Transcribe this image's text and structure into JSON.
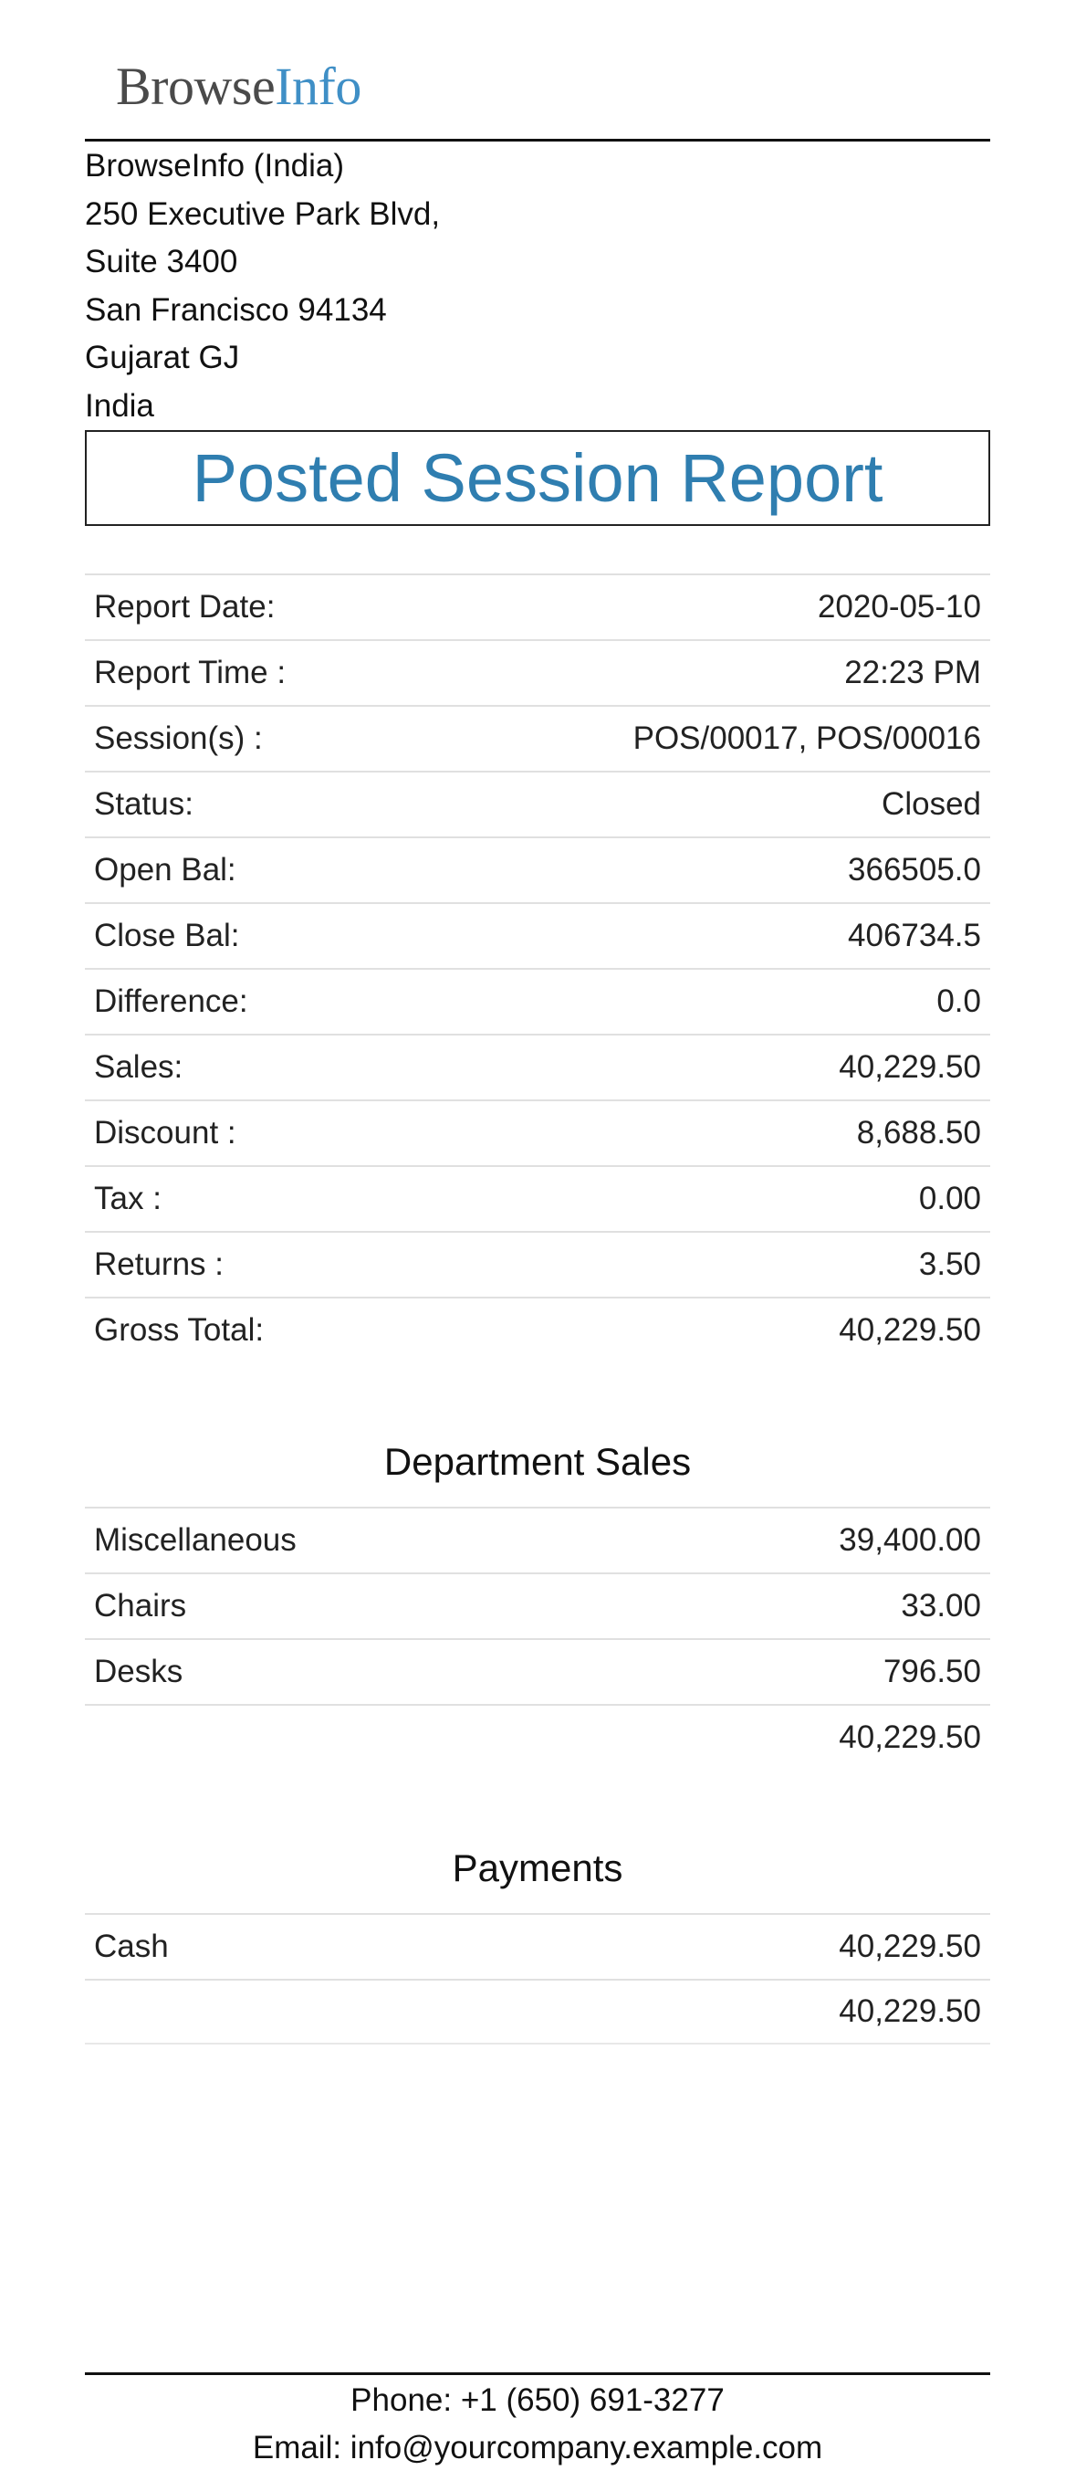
{
  "logo": {
    "part1": "Browse",
    "part2": "Info"
  },
  "company": {
    "name": "BrowseInfo (India)",
    "address_line1": "250 Executive Park Blvd,",
    "address_line2": "Suite 3400",
    "city_line": "San Francisco 94134",
    "state_line": "Gujarat GJ",
    "country": "India"
  },
  "report": {
    "title": "Posted Session Report",
    "summary": [
      {
        "label": "Report Date:",
        "value": "2020-05-10"
      },
      {
        "label": "Report Time :",
        "value": "22:23 PM"
      },
      {
        "label": "Session(s) :",
        "value": "POS/00017, POS/00016"
      },
      {
        "label": "Status:",
        "value": "Closed"
      },
      {
        "label": "Open Bal:",
        "value": "366505.0"
      },
      {
        "label": "Close Bal:",
        "value": "406734.5"
      },
      {
        "label": "Difference:",
        "value": "0.0"
      },
      {
        "label": "Sales:",
        "value": "40,229.50"
      },
      {
        "label": "Discount :",
        "value": "8,688.50"
      },
      {
        "label": "Tax :",
        "value": "0.00"
      },
      {
        "label": "Returns :",
        "value": "3.50"
      },
      {
        "label": "Gross Total:",
        "value": "40,229.50"
      }
    ]
  },
  "department_sales": {
    "title": "Department Sales",
    "rows": [
      {
        "label": "Miscellaneous",
        "value": "39,400.00"
      },
      {
        "label": "Chairs",
        "value": "33.00"
      },
      {
        "label": "Desks",
        "value": "796.50"
      }
    ],
    "total": "40,229.50"
  },
  "payments": {
    "title": "Payments",
    "rows": [
      {
        "label": "Cash",
        "value": "40,229.50"
      }
    ],
    "total": "40,229.50"
  },
  "footer": {
    "phone": "Phone: +1 (650) 691-3277",
    "email": "Email: info@yourcompany.example.com"
  }
}
